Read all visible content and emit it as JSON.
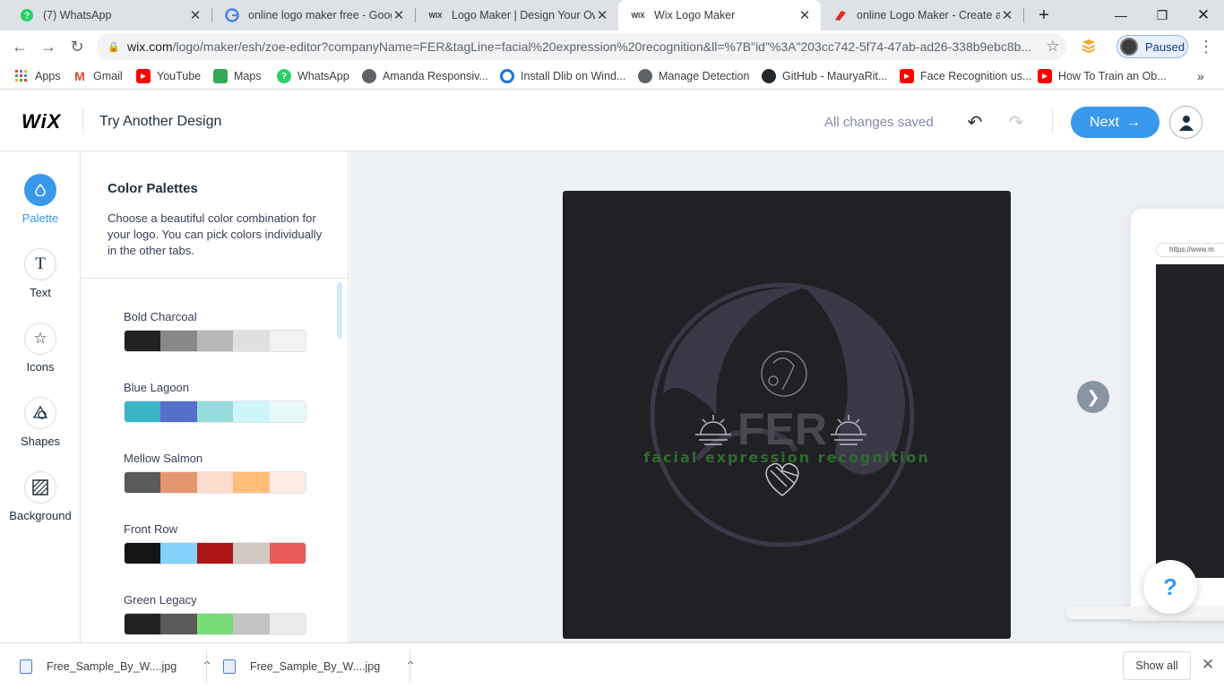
{
  "browser": {
    "tabs": [
      {
        "title": "(7) WhatsApp",
        "favicon": "whatsapp-icon",
        "color": "#25d366"
      },
      {
        "title": "online logo maker free - Goog",
        "favicon": "google-icon",
        "color": "#4285f4"
      },
      {
        "title": "Logo Maker | Design Your Own",
        "favicon": "wix-icon",
        "color": "#000000"
      },
      {
        "title": "Wix Logo Maker",
        "favicon": "wix-icon",
        "color": "#000000"
      },
      {
        "title": "online Logo Maker - Create a c",
        "favicon": "logo-maker-icon",
        "color": "#d93025"
      }
    ],
    "url_host": "wix.com",
    "url_rest": "/logo/maker/esh/zoe-editor?companyName=FER&tagLine=facial%20expression%20recognition&ll=%7B\"id\"%3A\"203cc742-5f74-47ab-ad26-338b9ebc8b...",
    "profile_status": "Paused",
    "bookmarks": [
      {
        "label": "Apps",
        "icon": "apps-grid-icon",
        "color": "#ea4335"
      },
      {
        "label": "Gmail",
        "icon": "gmail-icon",
        "color": "#ea4335"
      },
      {
        "label": "YouTube",
        "icon": "youtube-icon",
        "color": "#ff0000"
      },
      {
        "label": "Maps",
        "icon": "maps-icon",
        "color": "#34a853"
      },
      {
        "label": "WhatsApp",
        "icon": "whatsapp-icon",
        "color": "#25d366"
      },
      {
        "label": "Amanda Responsiv...",
        "icon": "globe-icon",
        "color": "#5f6368"
      },
      {
        "label": "Install Dlib on Wind...",
        "icon": "dlib-icon",
        "color": "#1a73e8"
      },
      {
        "label": "Manage Detection",
        "icon": "globe-icon",
        "color": "#5f6368"
      },
      {
        "label": "GitHub - MauryaRit...",
        "icon": "github-icon",
        "color": "#24292e"
      },
      {
        "label": "Face Recognition us...",
        "icon": "youtube-icon",
        "color": "#ff0000"
      },
      {
        "label": "How To Train an Ob...",
        "icon": "youtube-icon",
        "color": "#ff0000"
      }
    ]
  },
  "header": {
    "logo": "WiX",
    "title": "Try Another Design",
    "status": "All changes saved",
    "next_label": "Next"
  },
  "rail": [
    {
      "label": "Palette",
      "icon": "palette-drop-icon",
      "active": true
    },
    {
      "label": "Text",
      "icon": "text-icon",
      "active": false
    },
    {
      "label": "Icons",
      "icon": "star-icon",
      "active": false
    },
    {
      "label": "Shapes",
      "icon": "shapes-icon",
      "active": false
    },
    {
      "label": "Background",
      "icon": "background-hatch-icon",
      "active": false
    }
  ],
  "panel": {
    "title": "Color Palettes",
    "description": "Choose a beautiful color combination for your logo. You can pick colors individually in the other tabs.",
    "palettes": [
      {
        "name": "Bold Charcoal",
        "colors": [
          "#222222",
          "#888888",
          "#b8b8b8",
          "#e0e0e0",
          "#f2f2f2"
        ]
      },
      {
        "name": "Blue Lagoon",
        "colors": [
          "#3cb4c8",
          "#5470c8",
          "#96dcdc",
          "#cdf5fa",
          "#e6fafa"
        ]
      },
      {
        "name": "Mellow Salmon",
        "colors": [
          "#5a5a5a",
          "#e6966e",
          "#fadccd",
          "#ffbe78",
          "#ffebe1"
        ]
      },
      {
        "name": "Front Row",
        "colors": [
          "#141414",
          "#82d2fa",
          "#aa1414",
          "#d2c8c3",
          "#e65a5a"
        ]
      },
      {
        "name": "Green Legacy",
        "colors": [
          "#222222",
          "#5a5a5a",
          "#78dc78",
          "#c3c3c3",
          "#ebebeb"
        ]
      }
    ]
  },
  "logo": {
    "company_name": "FER",
    "tagline": "facial expression recognition",
    "background": "#212025",
    "accent": "#3c3848",
    "name_color": "#4a4751",
    "tagline_color": "#2e6b2e"
  },
  "stage": {
    "device_url": "https://www.m",
    "help_label": "?"
  },
  "downloads": {
    "items": [
      "Free_Sample_By_W....jpg",
      "Free_Sample_By_W....jpg"
    ],
    "show_all": "Show all"
  }
}
